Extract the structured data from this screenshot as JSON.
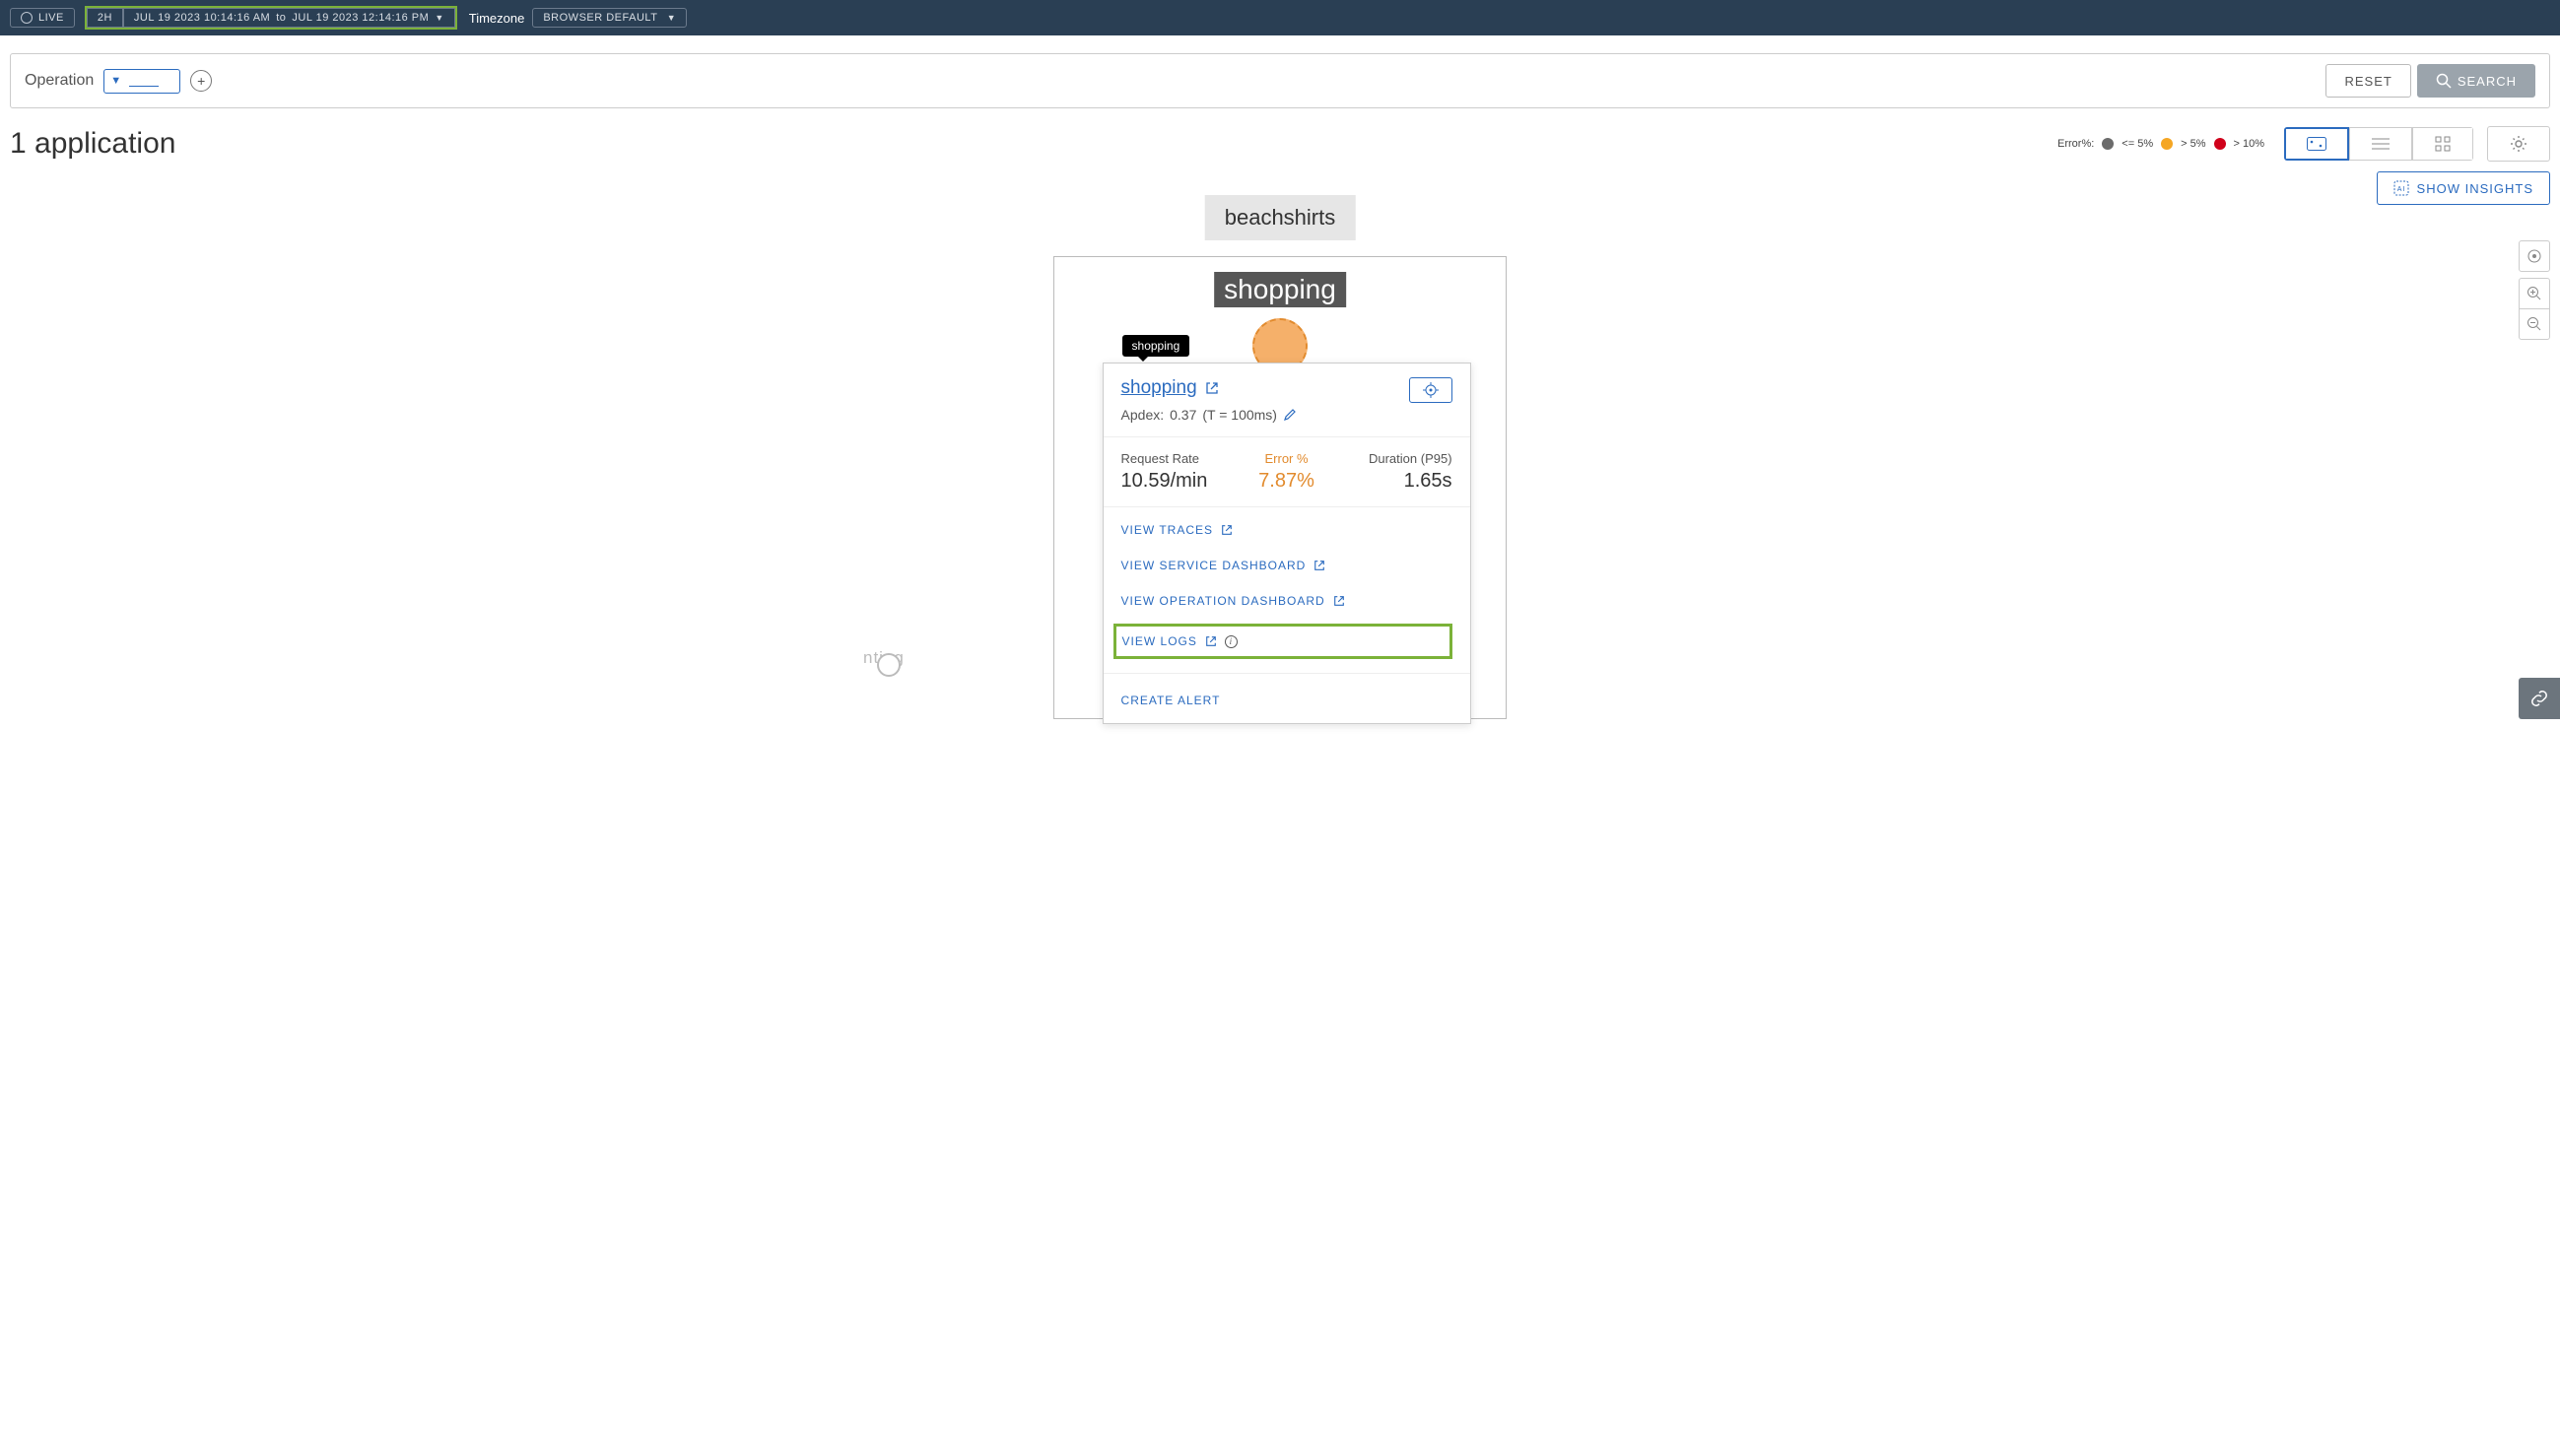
{
  "topbar": {
    "live": "LIVE",
    "duration": "2H",
    "date_from": "JUL 19 2023 10:14:16 AM",
    "date_to_sep": "to",
    "date_to": "JUL 19 2023 12:14:16 PM",
    "timezone_label": "Timezone",
    "timezone_value": "BROWSER DEFAULT"
  },
  "filterbar": {
    "operation_label": "Operation",
    "reset": "RESET",
    "search": "SEARCH"
  },
  "page": {
    "title": "1 application"
  },
  "legend": {
    "label": "Error%:",
    "le5": "<= 5%",
    "gt5": "> 5%",
    "gt10": "> 10%"
  },
  "insights": {
    "label": "SHOW INSIGHTS"
  },
  "app": {
    "name": "beachshirts",
    "service": "shopping",
    "other_label": "nting"
  },
  "tooltip": {
    "tag": "shopping",
    "title": "shopping",
    "apdex_label": "Apdex:",
    "apdex_value": "0.37",
    "apdex_t": "(T = 100ms)",
    "metrics": {
      "request_rate_label": "Request Rate",
      "request_rate_value": "10.59/min",
      "error_label": "Error %",
      "error_value": "7.87%",
      "duration_label": "Duration (P95)",
      "duration_value": "1.65s"
    },
    "links": {
      "view_traces": "VIEW TRACES",
      "view_service_dashboard": "VIEW SERVICE DASHBOARD",
      "view_operation_dashboard": "VIEW OPERATION DASHBOARD",
      "view_logs": "VIEW LOGS",
      "create_alert": "CREATE ALERT"
    }
  }
}
